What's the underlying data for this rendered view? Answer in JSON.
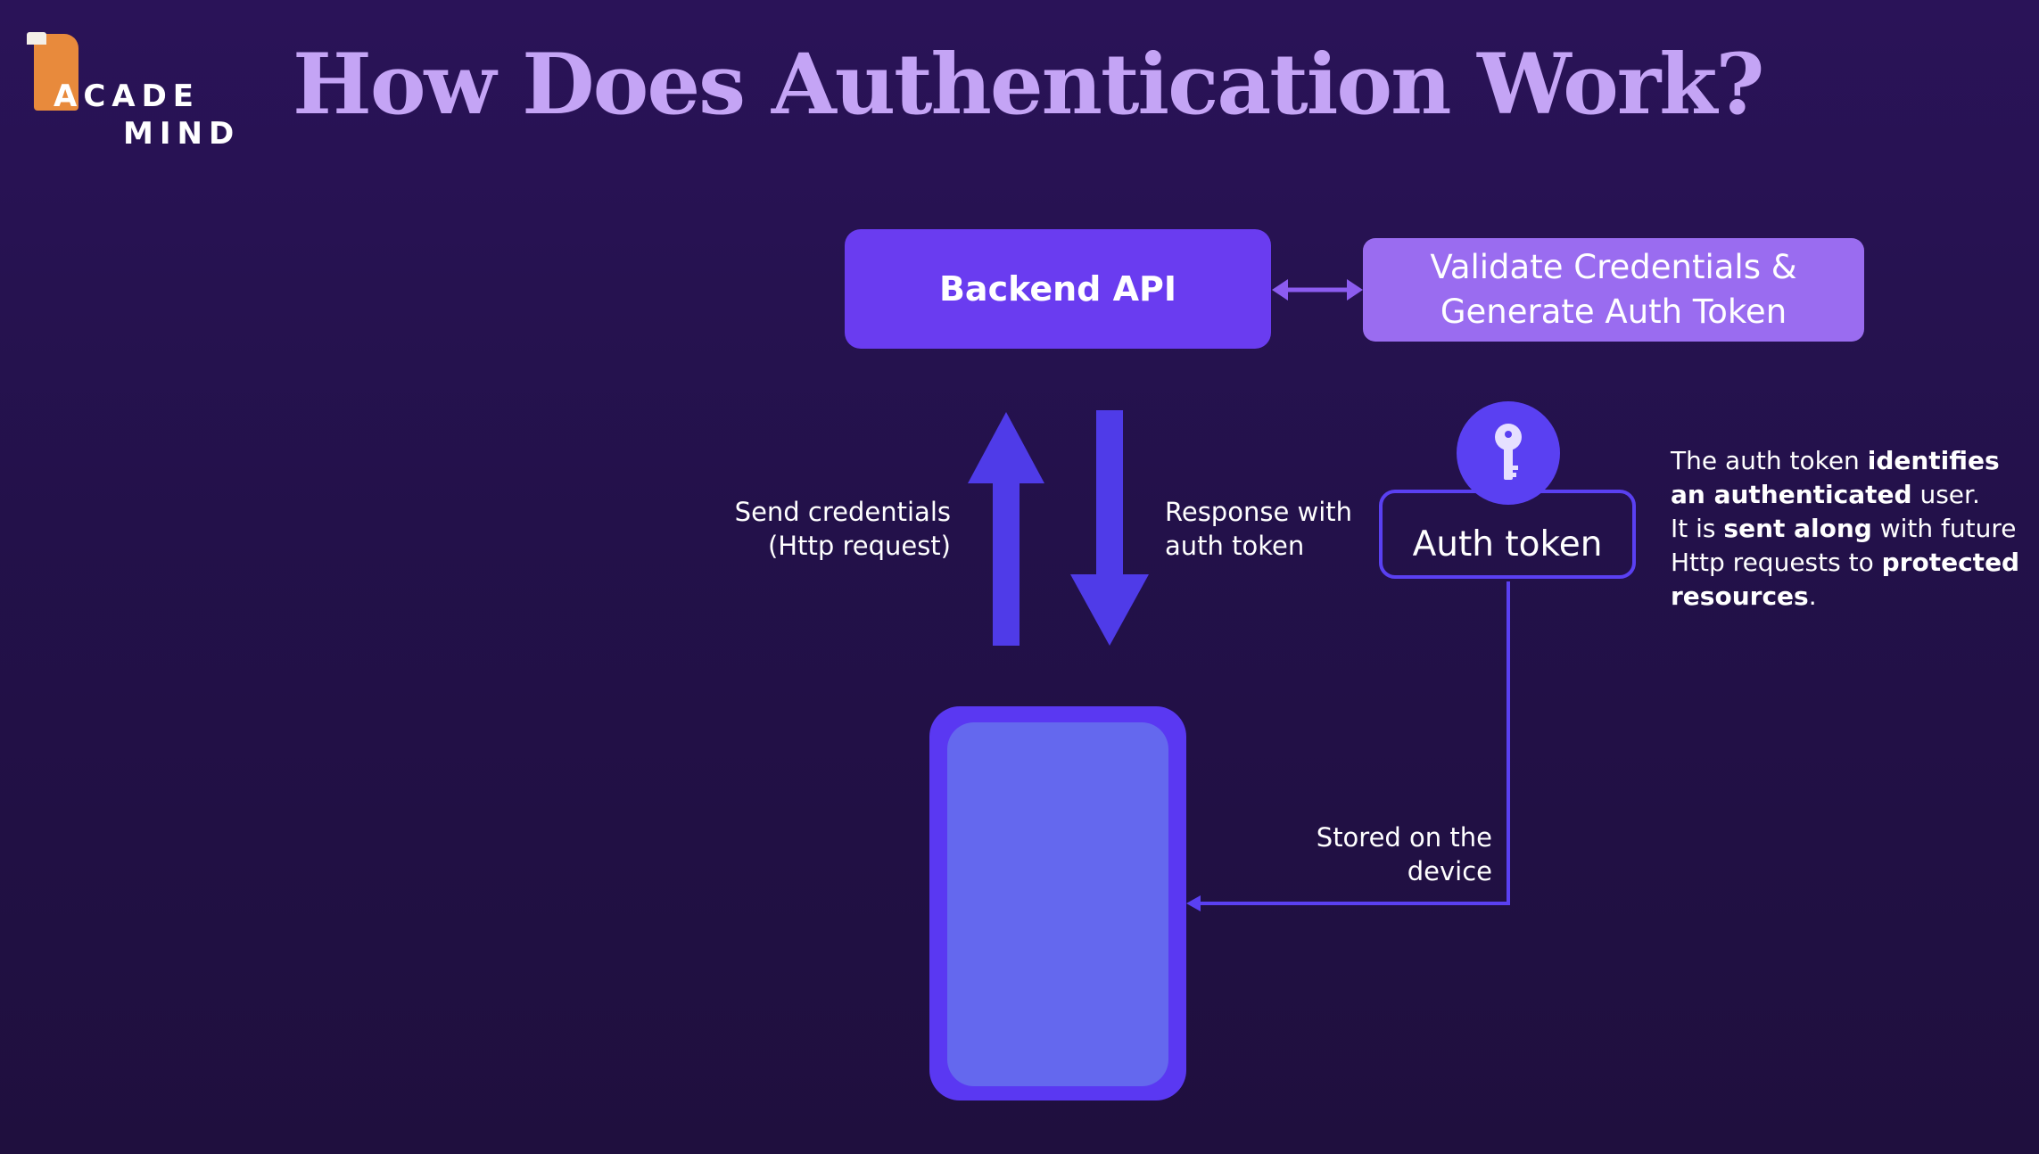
{
  "logo": {
    "line1": "ACADE",
    "line2": "MIND",
    "brand_color": "#e88a3c"
  },
  "title": "How Does Authentication Work?",
  "backend": {
    "label": "Backend API"
  },
  "validate": {
    "line1": "Validate Credentials &",
    "line2": "Generate Auth Token"
  },
  "auth_token": {
    "label": "Auth token",
    "icon": "key-icon"
  },
  "labels": {
    "send_line1": "Send credentials",
    "send_line2": "(Http request)",
    "response_line1": "Response with",
    "response_line2": "auth token",
    "stored_line1": "Stored on the",
    "stored_line2": "device"
  },
  "description": {
    "l1_plain": "The auth token ",
    "l1_bold": "identifies",
    "l2_bold": "an authenticated",
    "l2_plain": " user.",
    "l3_plain_a": "It is ",
    "l3_bold": "sent along",
    "l3_plain_b": " with future",
    "l4_plain": "Http requests to ",
    "l4_bold": "protected",
    "l5_bold": "resources",
    "l5_plain": "."
  },
  "colors": {
    "title": "#c4a4f5",
    "primary": "#6a3cf0",
    "secondary": "#9a6cf0",
    "arrow": "#4f3be8",
    "device_screen": "#6468ee"
  }
}
